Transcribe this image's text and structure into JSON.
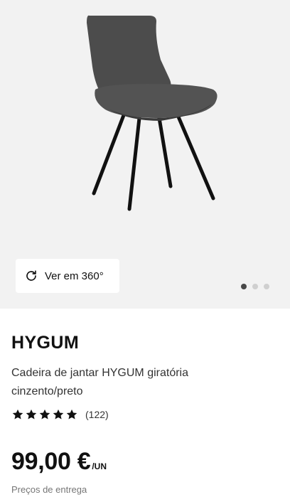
{
  "gallery": {
    "image_subject": "grey upholstered dining chair with black legs",
    "view360_label": "Ver em 360°",
    "view360_icon": "rotate-icon",
    "dots_total": 3,
    "active_dot": 1
  },
  "product": {
    "brand": "HYGUM",
    "description": "Cadeira de jantar HYGUM giratória cinzento/preto",
    "rating": 5,
    "review_count": "(122)",
    "price": "99,00 €",
    "unit": "/UN",
    "delivery_label": "Preços de entrega"
  },
  "colors": {
    "gallery_bg": "#f2f2f2",
    "active_dot": "#484848",
    "inactive_dot": "#cfcfcf",
    "star": "#111111"
  }
}
